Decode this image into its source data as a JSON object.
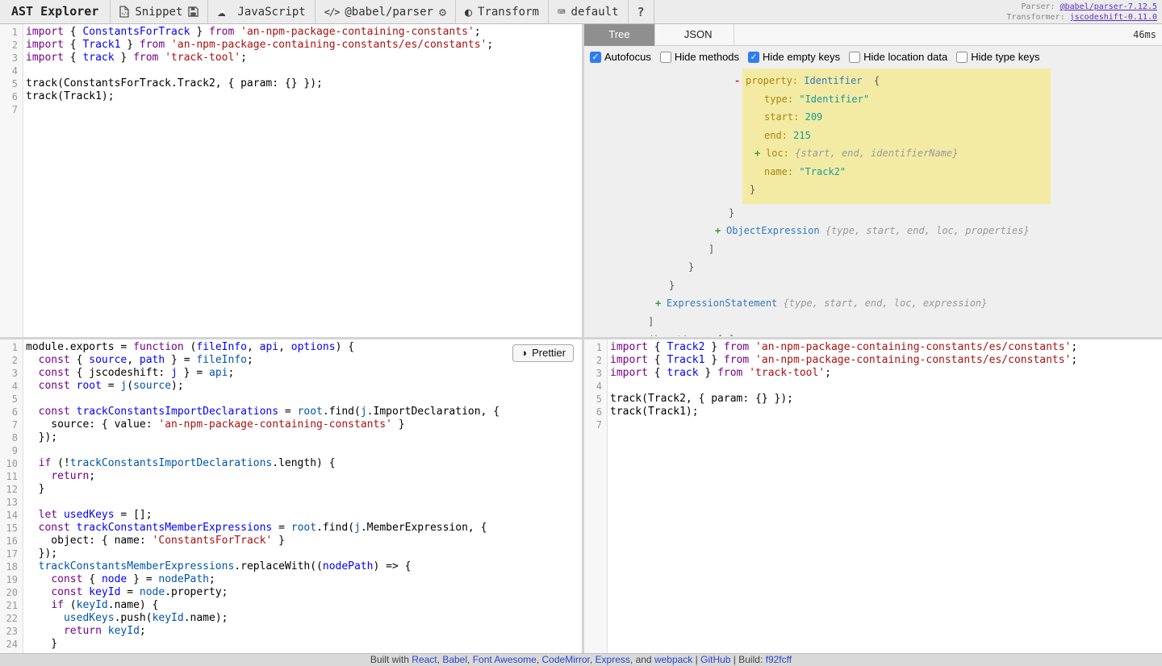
{
  "header": {
    "title": "AST Explorer",
    "snippet_label": "Snippet",
    "category_label": "JavaScript",
    "parser_label": "@babel/parser",
    "transform_label": "Transform",
    "keymap_label": "default",
    "help_label": "?",
    "code_icon_glyph": "</>",
    "toggle_icon_glyph": "◐",
    "gear_icon_glyph": "⚙",
    "keyboard_icon_glyph": "⌨",
    "cloud_icon_glyph": "☁",
    "parser_info_label": "Parser:",
    "parser_info_value": "@babel/parser-7.12.5",
    "transformer_info_label": "Transformer:",
    "transformer_info_value": "jscodeshift-0.11.0"
  },
  "tree_panel": {
    "tabs": [
      {
        "label": "Tree",
        "active": true
      },
      {
        "label": "JSON",
        "active": false
      }
    ],
    "timing": "46ms",
    "options": [
      {
        "label": "Autofocus",
        "checked": true
      },
      {
        "label": "Hide methods",
        "checked": false
      },
      {
        "label": "Hide empty keys",
        "checked": true
      },
      {
        "label": "Hide location data",
        "checked": false
      },
      {
        "label": "Hide type keys",
        "checked": false
      }
    ],
    "lines": [
      {
        "hl": true,
        "pad": 200,
        "marker": "-",
        "parts": [
          [
            "key",
            "property:"
          ],
          [
            "pun",
            " "
          ],
          [
            "typ",
            "Identifier"
          ],
          [
            "pun",
            "  {"
          ]
        ]
      },
      {
        "hl": true,
        "pad": 223,
        "parts": [
          [
            "key",
            "type:"
          ],
          [
            "pun",
            " "
          ],
          [
            "str",
            "\"Identifier\""
          ]
        ]
      },
      {
        "hl": true,
        "pad": 223,
        "parts": [
          [
            "key",
            "start:"
          ],
          [
            "pun",
            " "
          ],
          [
            "num",
            "209"
          ]
        ]
      },
      {
        "hl": true,
        "pad": 223,
        "parts": [
          [
            "key",
            "end:"
          ],
          [
            "pun",
            " "
          ],
          [
            "num",
            "215"
          ]
        ]
      },
      {
        "hl": true,
        "pad": 225,
        "marker": "+",
        "parts": [
          [
            "key",
            "loc:"
          ],
          [
            "pun",
            " "
          ],
          [
            "meta",
            "{start, end, identifierName}"
          ]
        ]
      },
      {
        "hl": true,
        "pad": 223,
        "parts": [
          [
            "key",
            "name:"
          ],
          [
            "pun",
            " "
          ],
          [
            "str",
            "\"Track2\""
          ]
        ]
      },
      {
        "hl": true,
        "pad": 205,
        "parts": [
          [
            "pun",
            "}"
          ]
        ]
      },
      {
        "pad": 179,
        "parts": [
          [
            "pun",
            "}"
          ]
        ]
      },
      {
        "pad": 176,
        "marker": "+",
        "parts": [
          [
            "typ",
            "ObjectExpression"
          ],
          [
            "pun",
            " "
          ],
          [
            "meta",
            "{type, start, end, loc, properties}"
          ]
        ]
      },
      {
        "pad": 154,
        "parts": [
          [
            "pun",
            "]"
          ]
        ]
      },
      {
        "pad": 129,
        "parts": [
          [
            "pun",
            "}"
          ]
        ]
      },
      {
        "pad": 105,
        "parts": [
          [
            "pun",
            "}"
          ]
        ]
      },
      {
        "pad": 102,
        "marker": "+",
        "parts": [
          [
            "typ",
            "ExpressionStatement"
          ],
          [
            "pun",
            " "
          ],
          [
            "meta",
            "{type, start, end, loc, expression}"
          ]
        ]
      },
      {
        "pad": 79,
        "parts": [
          [
            "pun",
            "]"
          ]
        ]
      },
      {
        "pad": 78,
        "parts": [
          [
            "key",
            "directives:"
          ],
          [
            "pun",
            " [ ]"
          ]
        ]
      }
    ]
  },
  "source_editor": {
    "lines": [
      [
        [
          "k",
          "import"
        ],
        [
          "p",
          " { "
        ],
        [
          "d",
          "ConstantsForTrack"
        ],
        [
          "p",
          " } "
        ],
        [
          "k",
          "from"
        ],
        [
          "p",
          " "
        ],
        [
          "s",
          "'an-npm-package-containing-constants'"
        ],
        [
          "p",
          ";"
        ]
      ],
      [
        [
          "k",
          "import"
        ],
        [
          "p",
          " { "
        ],
        [
          "d",
          "Track1"
        ],
        [
          "p",
          " } "
        ],
        [
          "k",
          "from"
        ],
        [
          "p",
          " "
        ],
        [
          "s",
          "'an-npm-package-containing-constants/es/constants'"
        ],
        [
          "p",
          ";"
        ]
      ],
      [
        [
          "k",
          "import"
        ],
        [
          "p",
          " { "
        ],
        [
          "d",
          "track"
        ],
        [
          "p",
          " } "
        ],
        [
          "k",
          "from"
        ],
        [
          "p",
          " "
        ],
        [
          "s",
          "'track-tool'"
        ],
        [
          "p",
          ";"
        ]
      ],
      [],
      [
        [
          "p",
          "track(ConstantsForTrack.Track2, { param: {} });"
        ]
      ],
      [
        [
          "p",
          "track(Track1);"
        ]
      ],
      []
    ]
  },
  "transform_editor": {
    "prettier_label": "Prettier",
    "prettier_icon_glyph": "◑",
    "lines": [
      [
        [
          "p",
          "module.exports = "
        ],
        [
          "k",
          "function"
        ],
        [
          "p",
          " ("
        ],
        [
          "d",
          "fileInfo"
        ],
        [
          "p",
          ", "
        ],
        [
          "d",
          "api"
        ],
        [
          "p",
          ", "
        ],
        [
          "d",
          "options"
        ],
        [
          "p",
          ") {"
        ]
      ],
      [
        [
          "p",
          "  "
        ],
        [
          "k",
          "const"
        ],
        [
          "p",
          " { "
        ],
        [
          "d",
          "source"
        ],
        [
          "p",
          ", "
        ],
        [
          "d",
          "path"
        ],
        [
          "p",
          " } = "
        ],
        [
          "v",
          "fileInfo"
        ],
        [
          "p",
          ";"
        ]
      ],
      [
        [
          "p",
          "  "
        ],
        [
          "k",
          "const"
        ],
        [
          "p",
          " { jscodeshift: "
        ],
        [
          "d",
          "j"
        ],
        [
          "p",
          " } = "
        ],
        [
          "v",
          "api"
        ],
        [
          "p",
          ";"
        ]
      ],
      [
        [
          "p",
          "  "
        ],
        [
          "k",
          "const"
        ],
        [
          "p",
          " "
        ],
        [
          "d",
          "root"
        ],
        [
          "p",
          " = "
        ],
        [
          "v",
          "j"
        ],
        [
          "p",
          "("
        ],
        [
          "v",
          "source"
        ],
        [
          "p",
          ");"
        ]
      ],
      [],
      [
        [
          "p",
          "  "
        ],
        [
          "k",
          "const"
        ],
        [
          "p",
          " "
        ],
        [
          "d",
          "trackConstantsImportDeclarations"
        ],
        [
          "p",
          " = "
        ],
        [
          "v",
          "root"
        ],
        [
          "p",
          ".find("
        ],
        [
          "v",
          "j"
        ],
        [
          "p",
          ".ImportDeclaration, {"
        ]
      ],
      [
        [
          "p",
          "    source: { value: "
        ],
        [
          "s",
          "'an-npm-package-containing-constants'"
        ],
        [
          "p",
          " }"
        ]
      ],
      [
        [
          "p",
          "  });"
        ]
      ],
      [],
      [
        [
          "p",
          "  "
        ],
        [
          "k",
          "if"
        ],
        [
          "p",
          " (!"
        ],
        [
          "v",
          "trackConstantsImportDeclarations"
        ],
        [
          "p",
          ".length) {"
        ]
      ],
      [
        [
          "p",
          "    "
        ],
        [
          "k",
          "return"
        ],
        [
          "p",
          ";"
        ]
      ],
      [
        [
          "p",
          "  }"
        ]
      ],
      [],
      [
        [
          "p",
          "  "
        ],
        [
          "k",
          "let"
        ],
        [
          "p",
          " "
        ],
        [
          "d",
          "usedKeys"
        ],
        [
          "p",
          " = [];"
        ]
      ],
      [
        [
          "p",
          "  "
        ],
        [
          "k",
          "const"
        ],
        [
          "p",
          " "
        ],
        [
          "d",
          "trackConstantsMemberExpressions"
        ],
        [
          "p",
          " = "
        ],
        [
          "v",
          "root"
        ],
        [
          "p",
          ".find("
        ],
        [
          "v",
          "j"
        ],
        [
          "p",
          ".MemberExpression, {"
        ]
      ],
      [
        [
          "p",
          "    object: { name: "
        ],
        [
          "s",
          "'ConstantsForTrack'"
        ],
        [
          "p",
          " }"
        ]
      ],
      [
        [
          "p",
          "  });"
        ]
      ],
      [
        [
          "p",
          "  "
        ],
        [
          "v",
          "trackConstantsMemberExpressions"
        ],
        [
          "p",
          ".replaceWith(("
        ],
        [
          "d",
          "nodePath"
        ],
        [
          "p",
          ") => {"
        ]
      ],
      [
        [
          "p",
          "    "
        ],
        [
          "k",
          "const"
        ],
        [
          "p",
          " { "
        ],
        [
          "d",
          "node"
        ],
        [
          "p",
          " } = "
        ],
        [
          "v",
          "nodePath"
        ],
        [
          "p",
          ";"
        ]
      ],
      [
        [
          "p",
          "    "
        ],
        [
          "k",
          "const"
        ],
        [
          "p",
          " "
        ],
        [
          "d",
          "keyId"
        ],
        [
          "p",
          " = "
        ],
        [
          "v",
          "node"
        ],
        [
          "p",
          ".property;"
        ]
      ],
      [
        [
          "p",
          "    "
        ],
        [
          "k",
          "if"
        ],
        [
          "p",
          " ("
        ],
        [
          "v",
          "keyId"
        ],
        [
          "p",
          ".name) {"
        ]
      ],
      [
        [
          "p",
          "      "
        ],
        [
          "v",
          "usedKeys"
        ],
        [
          "p",
          ".push("
        ],
        [
          "v",
          "keyId"
        ],
        [
          "p",
          ".name);"
        ]
      ],
      [
        [
          "p",
          "      "
        ],
        [
          "k",
          "return"
        ],
        [
          "p",
          " "
        ],
        [
          "v",
          "keyId"
        ],
        [
          "p",
          ";"
        ]
      ],
      [
        [
          "p",
          "    }"
        ]
      ]
    ]
  },
  "output_editor": {
    "lines": [
      [
        [
          "k",
          "import"
        ],
        [
          "p",
          " { "
        ],
        [
          "d",
          "Track2"
        ],
        [
          "p",
          " } "
        ],
        [
          "k",
          "from"
        ],
        [
          "p",
          " "
        ],
        [
          "s",
          "'an-npm-package-containing-constants/es/constants'"
        ],
        [
          "p",
          ";"
        ]
      ],
      [
        [
          "k",
          "import"
        ],
        [
          "p",
          " { "
        ],
        [
          "d",
          "Track1"
        ],
        [
          "p",
          " } "
        ],
        [
          "k",
          "from"
        ],
        [
          "p",
          " "
        ],
        [
          "s",
          "'an-npm-package-containing-constants/es/constants'"
        ],
        [
          "p",
          ";"
        ]
      ],
      [
        [
          "k",
          "import"
        ],
        [
          "p",
          " { "
        ],
        [
          "d",
          "track"
        ],
        [
          "p",
          " } "
        ],
        [
          "k",
          "from"
        ],
        [
          "p",
          " "
        ],
        [
          "s",
          "'track-tool'"
        ],
        [
          "p",
          ";"
        ]
      ],
      [],
      [
        [
          "p",
          "track(Track2, { param: {} });"
        ]
      ],
      [
        [
          "p",
          "track(Track1);"
        ]
      ],
      []
    ]
  },
  "footer": {
    "parts": [
      [
        "text",
        "Built with "
      ],
      [
        "link",
        "React"
      ],
      [
        "text",
        ", "
      ],
      [
        "link",
        "Babel"
      ],
      [
        "text",
        ", "
      ],
      [
        "link",
        "Font Awesome"
      ],
      [
        "text",
        ", "
      ],
      [
        "link",
        "CodeMirror"
      ],
      [
        "text",
        ", "
      ],
      [
        "link",
        "Express"
      ],
      [
        "text",
        ", and "
      ],
      [
        "link",
        "webpack"
      ],
      [
        "text",
        " | "
      ],
      [
        "link",
        "GitHub"
      ],
      [
        "text",
        " | Build: "
      ],
      [
        "link",
        "f92fcff"
      ]
    ]
  },
  "colors": {
    "tree_highlight": "#f3eba4",
    "active_tab_bg": "#8f8f8f",
    "keyword": "#770088",
    "definition": "#0000ff",
    "local_variable": "#0055aa",
    "string": "#aa1111",
    "tree_key": "#ad8508",
    "tree_type_link": "#2e7bbf",
    "tree_value": "#169b9b",
    "header_link": "#5b2fc0",
    "footer_link": "#2945cc"
  }
}
